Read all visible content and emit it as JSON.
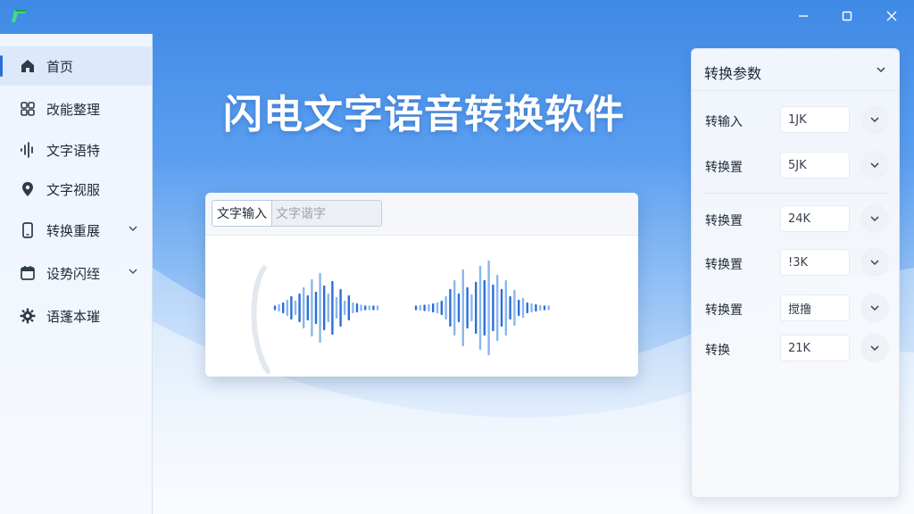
{
  "app": {
    "headline": "闪电文字语音转换软件"
  },
  "colors": {
    "accent": "#2b6fd6",
    "bg_top": "#3f8ae6",
    "wave_dark": "#2b6fd6",
    "wave_light": "#8ab6ee"
  },
  "window_controls": [
    "minimize",
    "maximize",
    "close"
  ],
  "sidebar": {
    "items": [
      {
        "label": "首页",
        "icon": "home-icon",
        "active": true,
        "expandable": false
      },
      {
        "label": "改能整理",
        "icon": "grid-icon",
        "active": false,
        "expandable": false
      },
      {
        "label": "文字语特",
        "icon": "audio-wave-icon",
        "active": false,
        "expandable": false
      },
      {
        "label": "文字视服",
        "icon": "location-pin-icon",
        "active": false,
        "expandable": false
      },
      {
        "label": "转换重展",
        "icon": "phone-icon",
        "active": false,
        "expandable": true
      },
      {
        "label": "设势闪绖",
        "icon": "calendar-icon",
        "active": false,
        "expandable": true
      },
      {
        "label": "语蓬本璀",
        "icon": "gear-icon",
        "active": false,
        "expandable": false
      }
    ]
  },
  "card": {
    "tabs": [
      {
        "label": "文字输入",
        "active": true
      },
      {
        "label": "文字谐字",
        "active": false
      }
    ]
  },
  "panel": {
    "title": "转换参数",
    "rows": [
      {
        "label": "转输入",
        "value": "1JK"
      },
      {
        "label": "转换置",
        "value": "5JK"
      },
      {
        "label": "转换置",
        "value": "24K"
      },
      {
        "label": "转换置",
        "value": "!3K"
      },
      {
        "label": "转换置",
        "value": "搅撸"
      },
      {
        "label": "转换",
        "value": "21K"
      }
    ]
  }
}
